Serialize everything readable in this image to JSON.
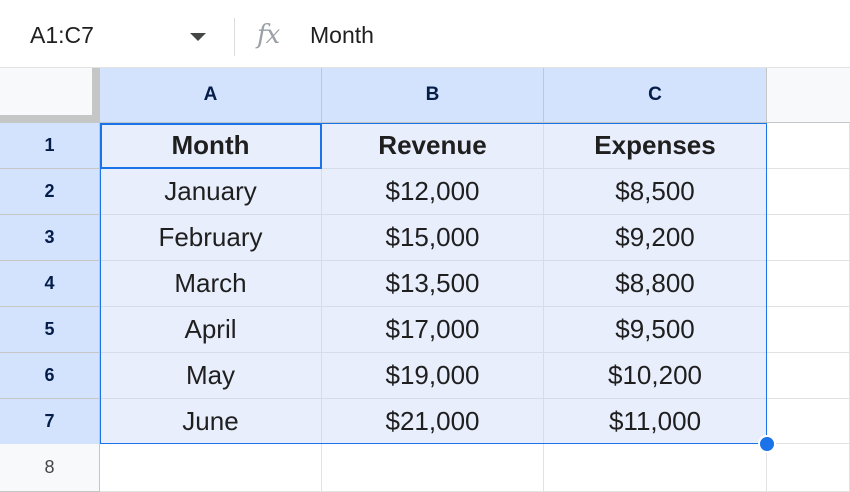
{
  "formula_bar": {
    "name_box": "A1:C7",
    "fx_label": "fx",
    "formula_value": "Month"
  },
  "columns": [
    "A",
    "B",
    "C"
  ],
  "rows": [
    "1",
    "2",
    "3",
    "4",
    "5",
    "6",
    "7",
    "8"
  ],
  "cells": [
    [
      "Month",
      "Revenue",
      "Expenses"
    ],
    [
      "January",
      "$12,000",
      "$8,500"
    ],
    [
      "February",
      "$15,000",
      "$9,200"
    ],
    [
      "March",
      "$13,500",
      "$8,800"
    ],
    [
      "April",
      "$17,000",
      "$9,500"
    ],
    [
      "May",
      "$19,000",
      "$10,200"
    ],
    [
      "June",
      "$21,000",
      "$11,000"
    ],
    [
      "",
      "",
      ""
    ]
  ],
  "colors": {
    "selection_fill": "#e8eefc",
    "header_highlight": "#d3e3fd",
    "accent": "#1a73e8"
  }
}
